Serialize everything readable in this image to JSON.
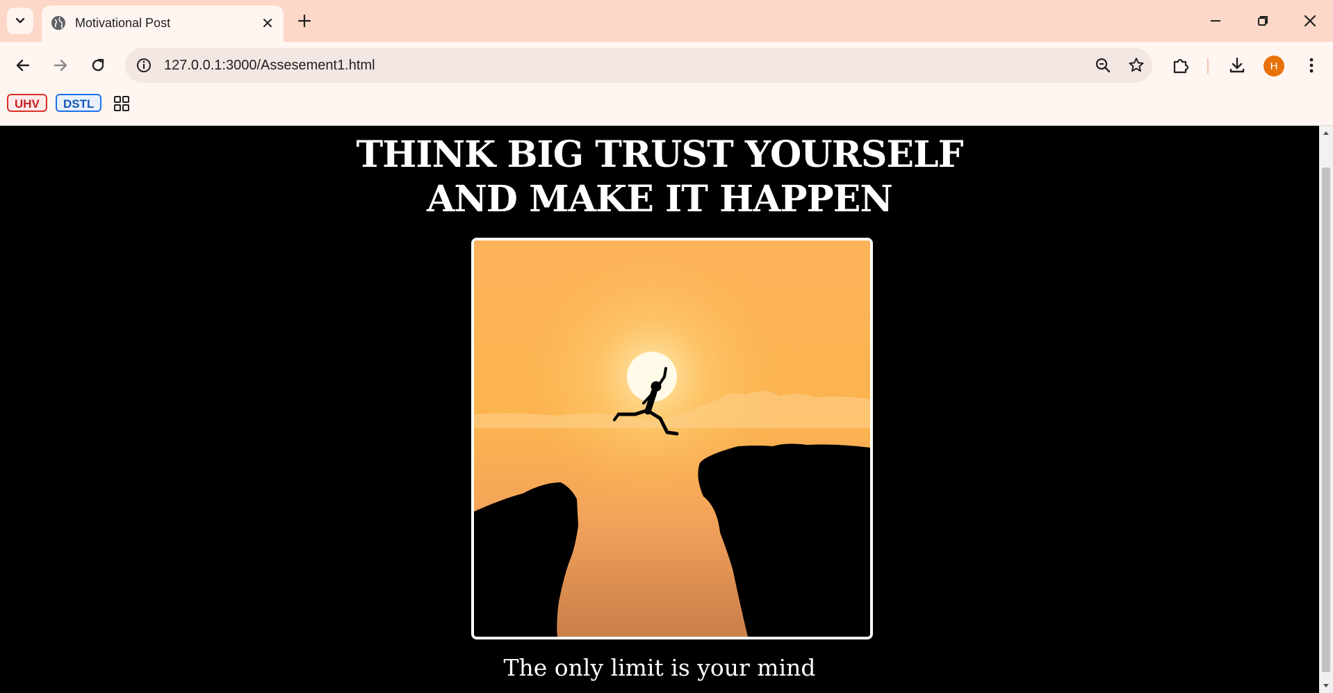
{
  "browser": {
    "tab": {
      "title": "Motivational Post",
      "icon": "globe-icon"
    },
    "address": {
      "url": "127.0.0.1:3000/Assesement1.html"
    },
    "profile_initial": "H",
    "bookmarks": [
      {
        "label": "UHV",
        "color": "#d93025"
      },
      {
        "label": "DSTL",
        "color": "#1a73e8"
      }
    ]
  },
  "page": {
    "headline_line1": "THINK BIG TRUST YOURSELF",
    "headline_line2": "AND MAKE IT HAPPEN",
    "caption": "The only limit is your mind",
    "background": "#000000",
    "text_color": "#ffffff"
  }
}
